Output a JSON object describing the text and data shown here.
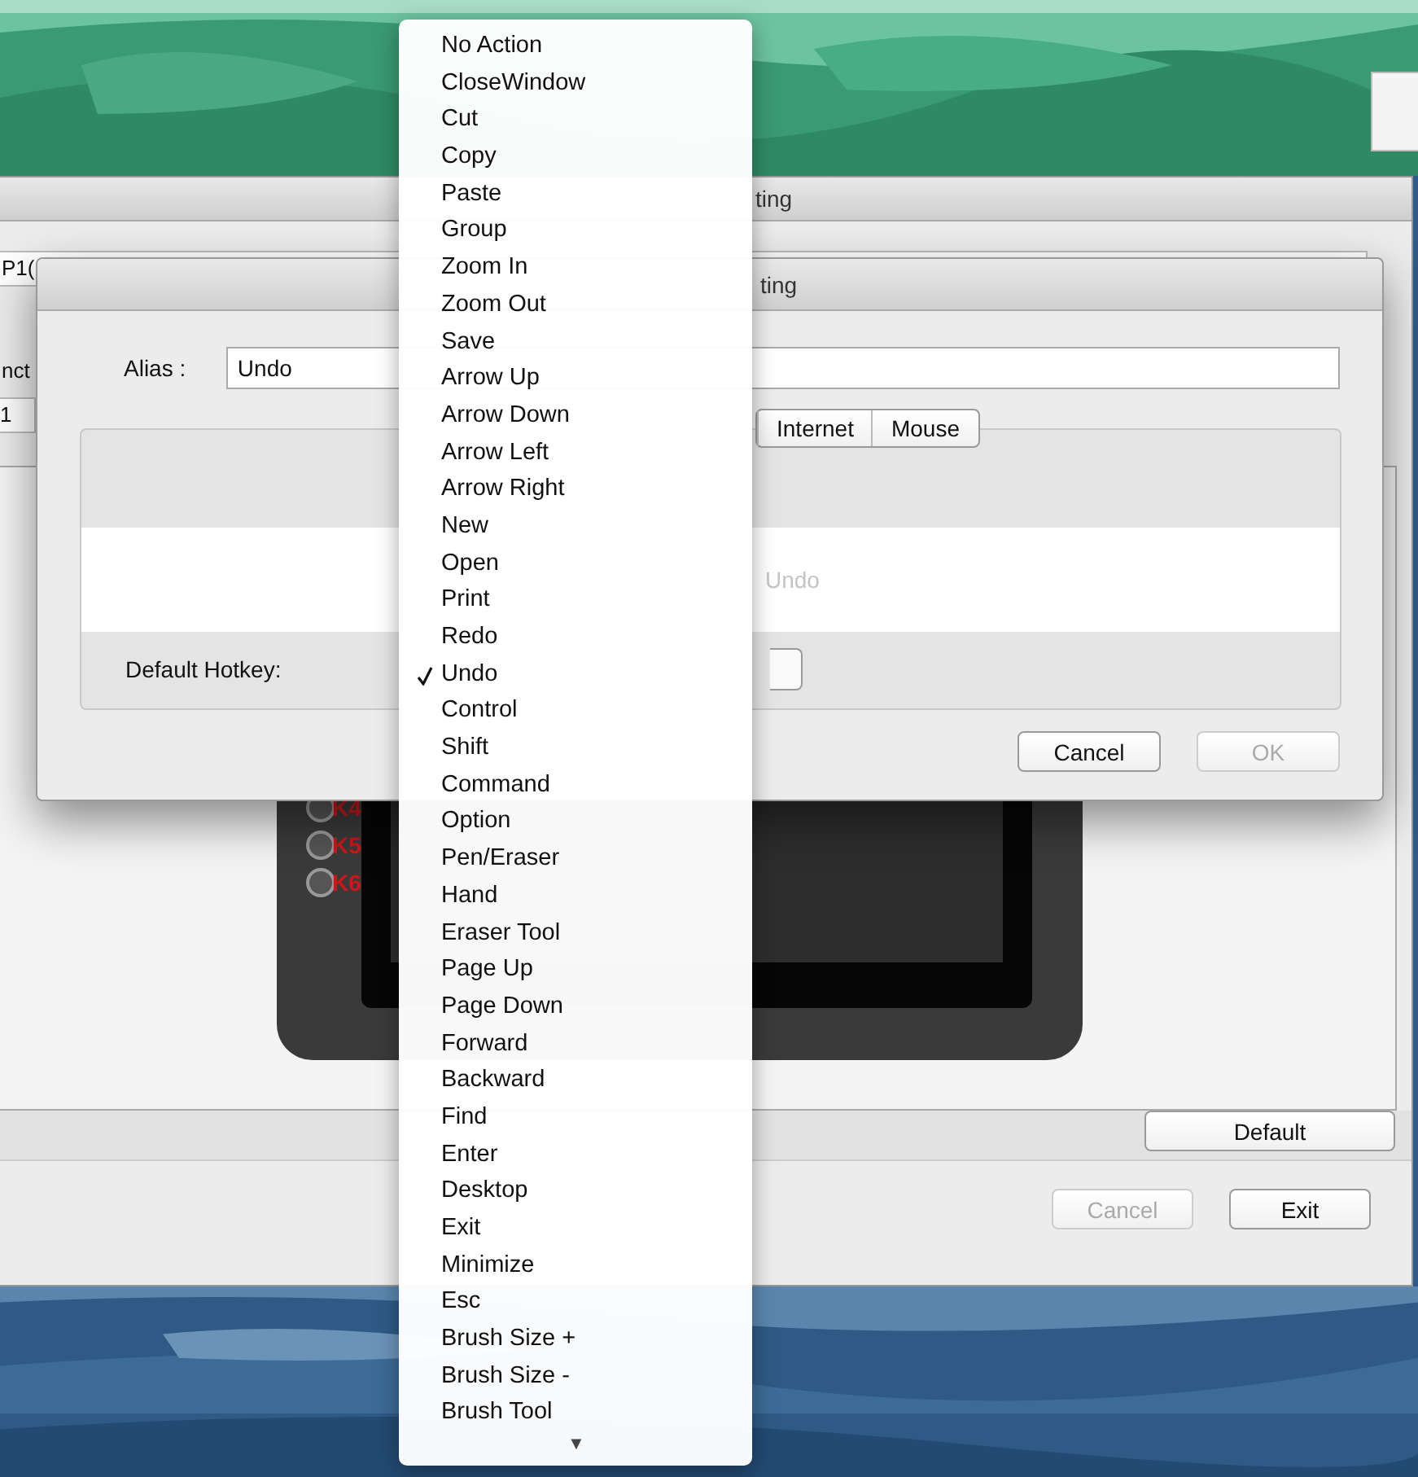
{
  "main_window": {
    "title": "ting",
    "device_field": "P1(",
    "label_fragment": "nct",
    "row_fragment": "1",
    "tablet_keys": [
      "K4",
      "K5",
      "K6"
    ],
    "default_button": "Default",
    "buttons": [
      {
        "label": "Cancel",
        "disabled": true
      },
      {
        "label": "Exit",
        "disabled": false
      }
    ]
  },
  "dialog": {
    "title": "ting",
    "alias_label": "Alias :",
    "alias_value": "Undo",
    "tabs": [
      {
        "label": "Internet",
        "selected": false
      },
      {
        "label": "Mouse",
        "selected": false
      }
    ],
    "preview_text": "Undo",
    "hotkey_label": "Default Hotkey:",
    "buttons": [
      {
        "label": "Cancel",
        "disabled": false
      },
      {
        "label": "OK",
        "disabled": true
      }
    ]
  },
  "menu": {
    "items": [
      {
        "label": "No Action",
        "checked": false
      },
      {
        "label": "CloseWindow",
        "checked": false
      },
      {
        "label": "Cut",
        "checked": false
      },
      {
        "label": "Copy",
        "checked": false
      },
      {
        "label": "Paste",
        "checked": false
      },
      {
        "label": "Group",
        "checked": false
      },
      {
        "label": "Zoom In",
        "checked": false
      },
      {
        "label": "Zoom Out",
        "checked": false
      },
      {
        "label": "Save",
        "checked": false
      },
      {
        "label": "Arrow Up",
        "checked": false
      },
      {
        "label": "Arrow Down",
        "checked": false
      },
      {
        "label": "Arrow Left",
        "checked": false
      },
      {
        "label": "Arrow Right",
        "checked": false
      },
      {
        "label": "New",
        "checked": false
      },
      {
        "label": "Open",
        "checked": false
      },
      {
        "label": "Print",
        "checked": false
      },
      {
        "label": "Redo",
        "checked": false
      },
      {
        "label": "Undo",
        "checked": true
      },
      {
        "label": "Control",
        "checked": false
      },
      {
        "label": "Shift",
        "checked": false
      },
      {
        "label": "Command",
        "checked": false
      },
      {
        "label": "Option",
        "checked": false
      },
      {
        "label": "Pen/Eraser",
        "checked": false
      },
      {
        "label": "Hand",
        "checked": false
      },
      {
        "label": "Eraser Tool",
        "checked": false
      },
      {
        "label": "Page Up",
        "checked": false
      },
      {
        "label": "Page Down",
        "checked": false
      },
      {
        "label": "Forward",
        "checked": false
      },
      {
        "label": "Backward",
        "checked": false
      },
      {
        "label": "Find",
        "checked": false
      },
      {
        "label": "Enter",
        "checked": false
      },
      {
        "label": "Desktop",
        "checked": false
      },
      {
        "label": "Exit",
        "checked": false
      },
      {
        "label": "Minimize",
        "checked": false
      },
      {
        "label": "Esc",
        "checked": false
      },
      {
        "label": "Brush Size +",
        "checked": false
      },
      {
        "label": "Brush Size -",
        "checked": false
      },
      {
        "label": "Brush Tool",
        "checked": false
      }
    ],
    "scroll_indicator": "▼"
  }
}
